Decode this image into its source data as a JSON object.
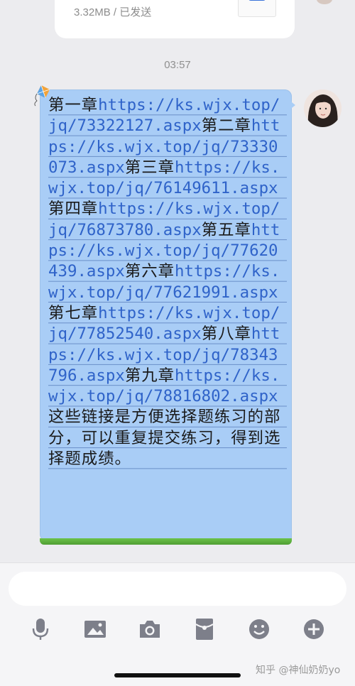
{
  "file_card": {
    "meta": "3.32MB / 已发送",
    "icon": "share-file-icon"
  },
  "timestamp": "03:57",
  "message": {
    "segments": [
      {
        "text": "第一章",
        "type": "text"
      },
      {
        "text": "https://ks.wjx.top/jq/73322127.aspx",
        "type": "link"
      },
      {
        "text": "第二章",
        "type": "text"
      },
      {
        "text": "https://ks.wjx.top/jq/73330073.aspx",
        "type": "link"
      },
      {
        "text": "第三章",
        "type": "text"
      },
      {
        "text": "https://ks.wjx.top/jq/76149611.aspx",
        "type": "link"
      },
      {
        "text": "第四章",
        "type": "text"
      },
      {
        "text": "https://ks.wjx.top/jq/76873780.aspx",
        "type": "link"
      },
      {
        "text": "第五章",
        "type": "text"
      },
      {
        "text": "https://ks.wjx.top/jq/77620439.aspx",
        "type": "link"
      },
      {
        "text": "第六章",
        "type": "text"
      },
      {
        "text": "https://ks.wjx.top/jq/77621991.aspx",
        "type": "link"
      },
      {
        "text": "第七章",
        "type": "text"
      },
      {
        "text": "https://ks.wjx.top/jq/77852540.aspx",
        "type": "link"
      },
      {
        "text": "第八章",
        "type": "text"
      },
      {
        "text": "https://ks.wjx.top/jq/78343796.aspx",
        "type": "link"
      },
      {
        "text": "第九章",
        "type": "text"
      },
      {
        "text": "https://ks.wjx.top/jq/78816802.aspx",
        "type": "link"
      },
      {
        "text": "这些链接是方便选择题练习的部分，可以重复提交练习，得到选择题成绩。",
        "type": "text"
      }
    ],
    "bubble_color": "#a9cdf6",
    "link_color": "#2f63c9",
    "decoration": "kite-icon"
  },
  "input": {
    "placeholder": ""
  },
  "toolbar": {
    "icons": [
      "microphone-icon",
      "image-icon",
      "camera-icon",
      "red-packet-icon",
      "emoji-icon",
      "add-icon"
    ]
  },
  "watermark": "知乎 @神仙奶奶yo"
}
